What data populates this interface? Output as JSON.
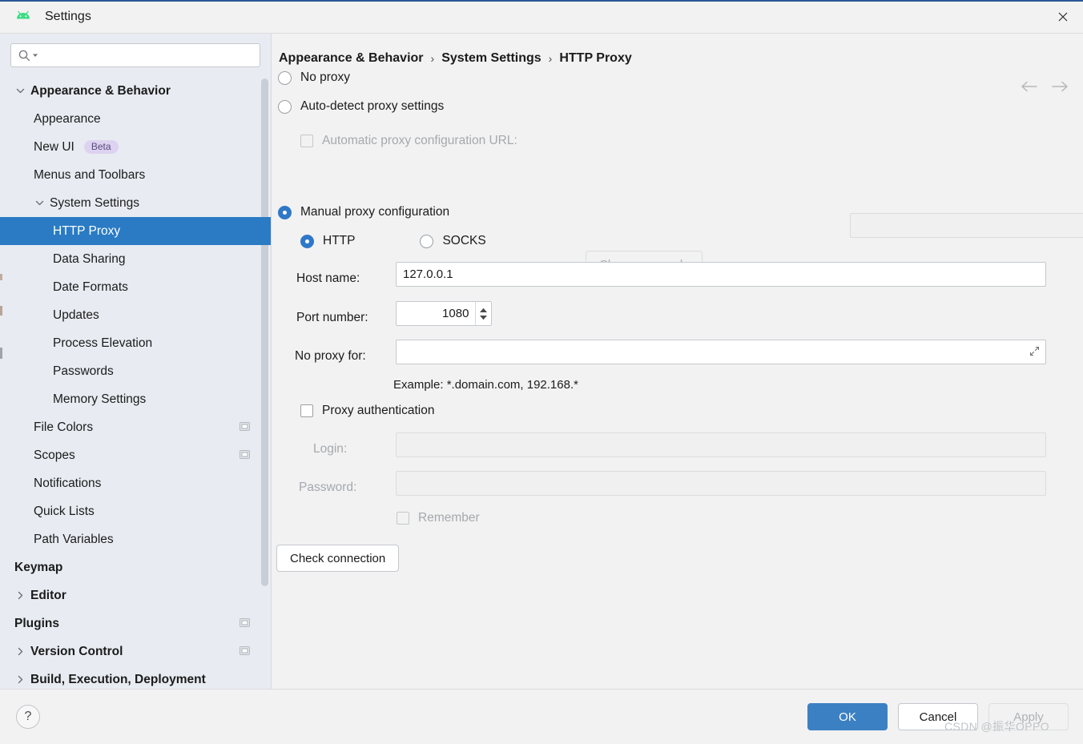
{
  "window": {
    "title": "Settings",
    "app_icon": "android-studio-icon",
    "close_icon": "close-icon",
    "accent_color": "#2b5797"
  },
  "sidebar": {
    "search": {
      "placeholder": "",
      "value": "",
      "icon": "search-icon",
      "dropdown_icon": "chevron-down-icon"
    },
    "items": [
      {
        "label": "Appearance & Behavior",
        "level": 0,
        "bold": true,
        "arrow": "expanded",
        "selected": false,
        "scope_icon": false
      },
      {
        "label": "Appearance",
        "level": 1,
        "bold": false,
        "arrow": "none",
        "selected": false,
        "scope_icon": false
      },
      {
        "label": "New UI",
        "level": 1,
        "bold": false,
        "arrow": "none",
        "selected": false,
        "scope_icon": false,
        "badge": "Beta"
      },
      {
        "label": "Menus and Toolbars",
        "level": 1,
        "bold": false,
        "arrow": "none",
        "selected": false,
        "scope_icon": false
      },
      {
        "label": "System Settings",
        "level": 1,
        "bold": false,
        "arrow": "expanded",
        "selected": false,
        "scope_icon": false
      },
      {
        "label": "HTTP Proxy",
        "level": 2,
        "bold": false,
        "arrow": "none",
        "selected": true,
        "scope_icon": false
      },
      {
        "label": "Data Sharing",
        "level": 2,
        "bold": false,
        "arrow": "none",
        "selected": false,
        "scope_icon": false
      },
      {
        "label": "Date Formats",
        "level": 2,
        "bold": false,
        "arrow": "none",
        "selected": false,
        "scope_icon": false
      },
      {
        "label": "Updates",
        "level": 2,
        "bold": false,
        "arrow": "none",
        "selected": false,
        "scope_icon": false
      },
      {
        "label": "Process Elevation",
        "level": 2,
        "bold": false,
        "arrow": "none",
        "selected": false,
        "scope_icon": false
      },
      {
        "label": "Passwords",
        "level": 2,
        "bold": false,
        "arrow": "none",
        "selected": false,
        "scope_icon": false
      },
      {
        "label": "Memory Settings",
        "level": 2,
        "bold": false,
        "arrow": "none",
        "selected": false,
        "scope_icon": false
      },
      {
        "label": "File Colors",
        "level": 1,
        "bold": false,
        "arrow": "none",
        "selected": false,
        "scope_icon": true
      },
      {
        "label": "Scopes",
        "level": 1,
        "bold": false,
        "arrow": "none",
        "selected": false,
        "scope_icon": true
      },
      {
        "label": "Notifications",
        "level": 1,
        "bold": false,
        "arrow": "none",
        "selected": false,
        "scope_icon": false
      },
      {
        "label": "Quick Lists",
        "level": 1,
        "bold": false,
        "arrow": "none",
        "selected": false,
        "scope_icon": false
      },
      {
        "label": "Path Variables",
        "level": 1,
        "bold": false,
        "arrow": "none",
        "selected": false,
        "scope_icon": false
      },
      {
        "label": "Keymap",
        "level": 0,
        "bold": true,
        "arrow": "none",
        "selected": false,
        "scope_icon": false
      },
      {
        "label": "Editor",
        "level": 0,
        "bold": true,
        "arrow": "collapsed",
        "selected": false,
        "scope_icon": false
      },
      {
        "label": "Plugins",
        "level": 0,
        "bold": true,
        "arrow": "none",
        "selected": false,
        "scope_icon": true
      },
      {
        "label": "Version Control",
        "level": 0,
        "bold": true,
        "arrow": "collapsed",
        "selected": false,
        "scope_icon": true
      },
      {
        "label": "Build, Execution, Deployment",
        "level": 0,
        "bold": true,
        "arrow": "collapsed",
        "selected": false,
        "scope_icon": false
      }
    ],
    "selected_bg": "#2a7bc4"
  },
  "content": {
    "breadcrumb": [
      "Appearance & Behavior",
      "System Settings",
      "HTTP Proxy"
    ],
    "nav": {
      "back_icon": "arrow-left-icon",
      "forward_icon": "arrow-right-icon"
    },
    "proxy_mode": {
      "no_proxy_label": "No proxy",
      "auto_detect_label": "Auto-detect proxy settings",
      "manual_label": "Manual proxy configuration",
      "selected": "manual"
    },
    "auto_detect": {
      "pac_checkbox_label": "Automatic proxy configuration URL:",
      "pac_checked": false,
      "pac_url_value": "",
      "clear_passwords_label": "Clear passwords",
      "enabled": false
    },
    "manual": {
      "protocol_selected": "HTTP",
      "http_label": "HTTP",
      "socks_label": "SOCKS",
      "host_label": "Host name:",
      "host_value": "127.0.0.1",
      "port_label": "Port number:",
      "port_value": "1080",
      "no_proxy_label": "No proxy for:",
      "no_proxy_value": "",
      "example_text": "Example: *.domain.com, 192.168.*",
      "expand_icon": "expand-icon"
    },
    "auth": {
      "checkbox_label": "Proxy authentication",
      "checked": false,
      "login_label": "Login:",
      "login_value": "",
      "password_label": "Password:",
      "password_value": "",
      "remember_label": "Remember",
      "remember_checked": false
    },
    "check_connection_label": "Check connection"
  },
  "footer": {
    "help_icon": "help-icon",
    "help_label": "?",
    "ok_label": "OK",
    "cancel_label": "Cancel",
    "apply_label": "Apply",
    "apply_enabled": false,
    "primary_color": "#3c80c4"
  },
  "watermark": "CSDN @振华OPPO"
}
